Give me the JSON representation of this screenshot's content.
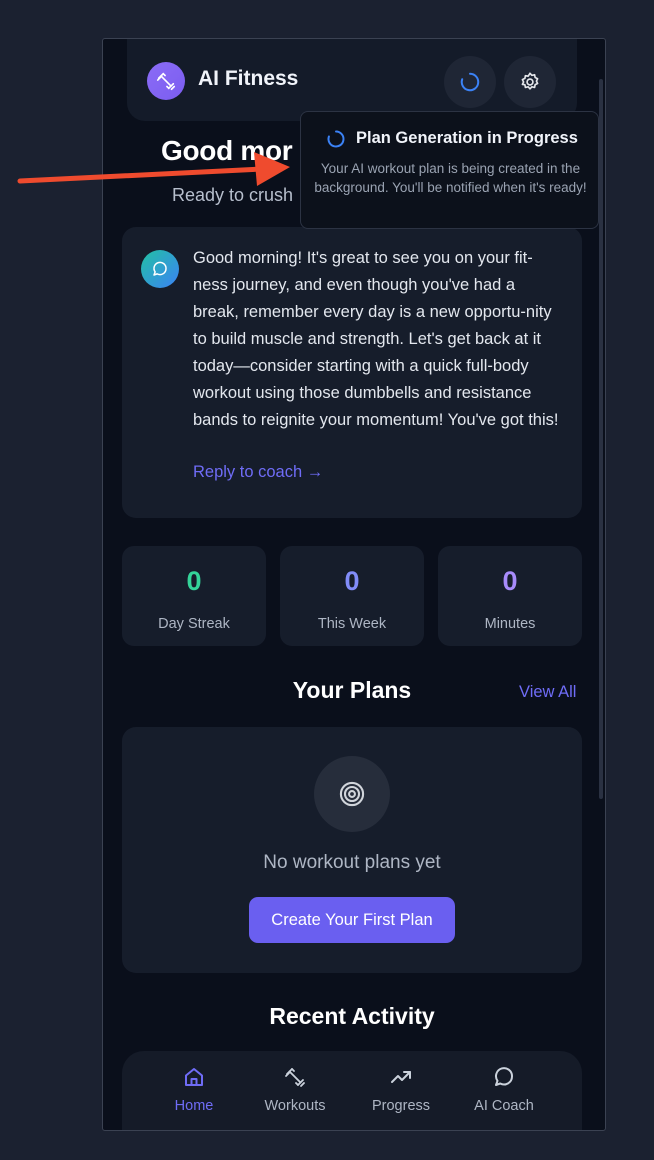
{
  "app": {
    "title": "AI Fitness"
  },
  "greeting": {
    "title": "Good mor",
    "subtitle": "Ready to crush"
  },
  "coach_card": {
    "message": "Good morning! It's great to see you on your fit-ness journey, and even though you've had a break, remember every day is a new opportu-nity to build muscle and strength. Let's get back at it today—consider starting with a quick full-body workout using those dumbbells and resistance bands to reignite your momentum! You've got this!",
    "reply_label": "Reply to coach →"
  },
  "stats": [
    {
      "value": "0",
      "label": "Day Streak",
      "color": "#34d399"
    },
    {
      "value": "0",
      "label": "This Week",
      "color": "#818cf8"
    },
    {
      "value": "0",
      "label": "Minutes",
      "color": "#a78bfa"
    }
  ],
  "plans": {
    "title": "Your Plans",
    "view_all": "View All",
    "empty_text": "No workout plans yet",
    "create_label": "Create Your First Plan"
  },
  "recent": {
    "title": "Recent Activity"
  },
  "nav": {
    "items": [
      {
        "label": "Home",
        "icon": "home-icon",
        "active": true
      },
      {
        "label": "Workouts",
        "icon": "dumbbell-icon",
        "active": false
      },
      {
        "label": "Progress",
        "icon": "trending-up-icon",
        "active": false
      },
      {
        "label": "AI Coach",
        "icon": "chat-icon",
        "active": false
      }
    ]
  },
  "toast": {
    "title": "Plan Generation in Progress",
    "body": "Your AI workout plan is being created in the background. You'll be notified when it's ready!"
  },
  "colors": {
    "accent": "#6a5ff0",
    "background": "#0a0f1b",
    "card": "#161d2b",
    "annotation": "#ef4b2e"
  }
}
